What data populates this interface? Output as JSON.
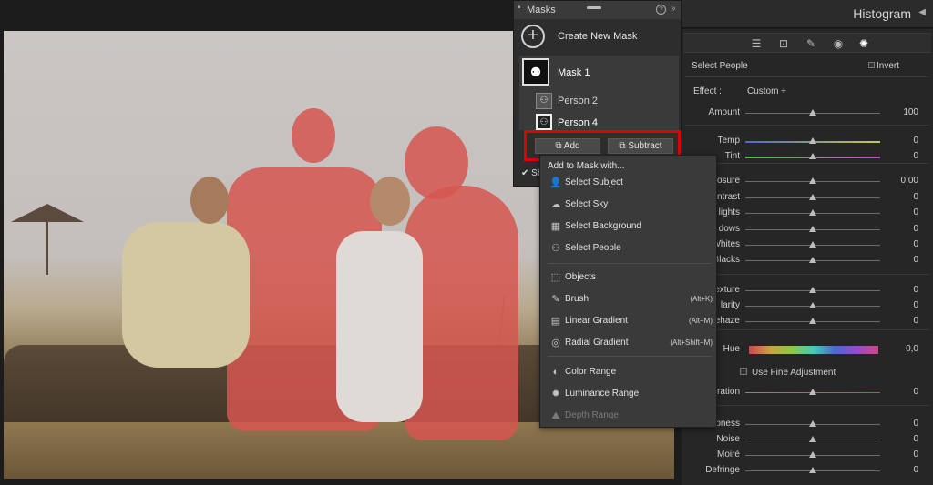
{
  "histogram": {
    "title": "Histogram"
  },
  "masks": {
    "title": "Masks",
    "create_label": "Create New Mask",
    "mask1_label": "Mask 1",
    "person2_label": "Person 2",
    "person4_label": "Person 4",
    "add_label": "Add",
    "subtract_label": "Subtract",
    "show_overlay": "Sh"
  },
  "dropdown": {
    "header": "Add to Mask with...",
    "items": [
      {
        "label": "Select Subject",
        "shortcut": "",
        "icon": "person-icon"
      },
      {
        "label": "Select Sky",
        "shortcut": "",
        "icon": "sky-icon"
      },
      {
        "label": "Select Background",
        "shortcut": "",
        "icon": "background-icon"
      },
      {
        "label": "Select People",
        "shortcut": "",
        "icon": "people-icon"
      },
      {
        "label": "Objects",
        "shortcut": "",
        "icon": "objects-icon"
      },
      {
        "label": "Brush",
        "shortcut": "(Alt+K)",
        "icon": "brush-icon"
      },
      {
        "label": "Linear Gradient",
        "shortcut": "(Alt+M)",
        "icon": "linear-gradient-icon"
      },
      {
        "label": "Radial Gradient",
        "shortcut": "(Alt+Shift+M)",
        "icon": "radial-gradient-icon"
      },
      {
        "label": "Color Range",
        "shortcut": "",
        "icon": "color-range-icon"
      },
      {
        "label": "Luminance Range",
        "shortcut": "",
        "icon": "luminance-range-icon"
      },
      {
        "label": "Depth Range",
        "shortcut": "",
        "icon": "depth-range-icon",
        "disabled": true
      }
    ]
  },
  "panel": {
    "section_label": "Select People",
    "invert_label": "Invert",
    "effect_label": "Effect :",
    "effect_value": "Custom ÷",
    "hue_label": "Hue",
    "hue_value": "0,0",
    "fine_label": "Use Fine Adjustment",
    "sliders": [
      {
        "label": "Amount",
        "value": "100",
        "level": 0.5
      },
      {
        "label": "Temp",
        "value": "0",
        "level": 0.5
      },
      {
        "label": "Tint",
        "value": "0",
        "level": 0.5
      },
      {
        "label": "osure",
        "value": "0,00",
        "level": 0.5
      },
      {
        "label": "ntrast",
        "value": "0",
        "level": 0.5
      },
      {
        "label": "lights",
        "value": "0",
        "level": 0.5
      },
      {
        "label": "dows",
        "value": "0",
        "level": 0.5
      },
      {
        "label": "Whites",
        "value": "0",
        "level": 0.5
      },
      {
        "label": "Blacks",
        "value": "0",
        "level": 0.5
      },
      {
        "label": "exture",
        "value": "0",
        "level": 0.5
      },
      {
        "label": "larity",
        "value": "0",
        "level": 0.5
      },
      {
        "label": "ehaze",
        "value": "0",
        "level": 0.5
      },
      {
        "label": "ration",
        "value": "0",
        "level": 0.5
      },
      {
        "label": "pness",
        "value": "0",
        "level": 0.5
      },
      {
        "label": "Noise",
        "value": "0",
        "level": 0.5
      },
      {
        "label": "Moiré",
        "value": "0",
        "level": 0.5
      },
      {
        "label": "Defringe",
        "value": "0",
        "level": 0.5
      }
    ]
  }
}
